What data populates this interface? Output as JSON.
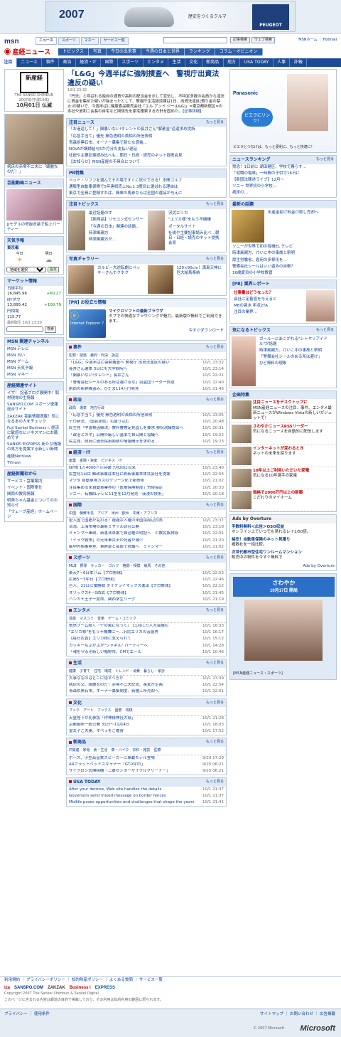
{
  "ad": {
    "year": "2007",
    "copy": "歴史をつくるクルマ",
    "brand": "PEUGEOT"
  },
  "header": {
    "logo": "msn",
    "tabs": [
      "ニュース",
      "スポーツ",
      "マネー",
      "サービス一覧"
    ],
    "search_btn1": "記事検索",
    "search_btn2": "ウェブ検索",
    "links": "MSNホーム ｜ Hotmail",
    "brand": "産経ニュース"
  },
  "subnav": [
    "トピックス",
    "写真",
    "今日の出来事",
    "今週の日本と世界",
    "ランキング",
    "コラム・オピニオン"
  ],
  "mainnav": [
    "注目",
    "ニュース",
    "事件",
    "政治",
    "経済・IT",
    "国際",
    "スポーツ",
    "エンタメ",
    "生活",
    "文化",
    "新商品",
    "地方",
    "USA TODAY",
    "人事",
    "訃報"
  ],
  "left": {
    "paper_title": "新産経",
    "paper_sub": "THE SANKEI SHIMBUN",
    "date": "2007年(平成19年)",
    "date2": "10月01日 仏滅",
    "girl_caption": "病床の赤塚不二夫に「綺麗なのだ！」",
    "ent_head": "芸能動画ニュース",
    "ent_caption": "JJモデルの奇抜衣装で船上パーティー",
    "weather_head": "天気予報",
    "weather_city": "東京都",
    "weather_today": "今日",
    "weather_tomorrow": "明日",
    "weather_sel": "地域を選択",
    "weather_btn": "設定",
    "market_head": "マーケット情報",
    "market": [
      {
        "name": "日経平均",
        "val": "16,845.96",
        "chg": "+60.27"
      },
      {
        "name": "NYダウ",
        "val": "13,895.42",
        "chg": "+100.79"
      },
      {
        "name": "円相場",
        "val": "115.77",
        "chg": ""
      }
    ],
    "market_time": "最終取引 10/1 23:50",
    "stock_btn": "検索",
    "channel_head": "MSN 関連チャンネル",
    "channels": [
      "MSN テレビ",
      "MSN 占い",
      "MSN ゲーム",
      "MSN 天気予報",
      "MSN マネー"
    ],
    "sankei_head": "産経関連サイト",
    "sankei": [
      "イザ！ 記者ブログ展開中！取材現場の生情報",
      "SANSPO.COM スポーツ速報総合サイト",
      "ZAKZAK 芸能情報満載！気になるあの人をチェック",
      "Fuji Sankei Business i. 経済に敏感なビジネスマンにお薦めです",
      "SANKEI EXPRESS 新たな情報の見方を提案する新しい新聞",
      "産経NetView",
      "TVnavi"
    ],
    "corp_head": "産経新聞社から",
    "corp": [
      "サービス・営業案内",
      "イベント・国際奉仕",
      "関西の教育情報",
      "明美ちゃん基金についてのお知らせ",
      "「ウェーブ産経」ホームページ"
    ]
  },
  "center": {
    "lead_title": "「L&G」今週半ばに強制捜査へ　警視庁出資法違反の疑い",
    "lead_time": "10/1 23:32",
    "lead_body": "「円天」と呼ばれる独自の通貨や高利の配当金を示して宣伝し、不特定多数の会員から違法に資金を集めた疑いが強まったとして、警視庁生活経済課は1日、出資法違反(預り金の禁止)の疑いで、今週半ばに健康食品販売会社「エル アンド ジー(L&G)」=東京都新宿区=の本社や波和二会長の自宅など関係先を家宅捜索する方針を固めた。",
    "lead_more": "【記事詳細】",
    "chumoku_head": "注目ニュース",
    "more": "もっと見る",
    "chumoku": [
      "「お追返して！」関暴いない!タレントの長井さん\"解散金\"返還求め提訴",
      "「応急手当て」優先 無色透明の首相の所信表明",
      "青森県黒石市、オーナー募集で新たな感電…",
      "NOVAが講師給与5か月分の支払い遅延",
      "社説や主要記事読み比べも…朝日・日経・読売のネット提携会見",
      "【お知らせ】MSN産経の不具合について"
    ],
    "pr_head": "PR特集",
    "pr": [
      "ベッド・ソファを選んでその場ですぐに試せできる！本間ゴルフ",
      "通販型自動車保険で5年連続売上No.1 3度目に選ばれる理由は",
      "東京で全員に登録すれば、簡単の馬券ならば全国の選品が与えに"
    ],
    "topic_head": "注目トピックス",
    "topic_a": [
      "最近話題のIT",
      "【新商品】リモコン式センサー",
      "「今週の日本」関連の話題…",
      "時津風親方",
      "時津風親方が…"
    ],
    "topic_b": [
      "沢尻エリカ",
      "\"エリカ様\"をもう不機嫌",
      "ポータルサイト",
      "社説や主要記事読み比べ…朝日・日経・読売のネット提携会見"
    ],
    "photo_head": "写真ギャラリー",
    "photo_a": "カルビー大逆転劇にペッキーさんホクホク",
    "photo_b": "120×90cm！満島天神に巨大絵馬奉納",
    "ie_head": "[PR] お役立ち情報",
    "ie_title": "マイクロソフトの最新ブラウザ",
    "ie_body": "タブでの快適なブラウジングが魅力。最新版が無料でご利用できます。",
    "ie_more": "今すぐダウンロード",
    "ie_logo": "Internet Explorer 7",
    "jiken_head": "事件",
    "jiken_cats": "犯罪・疑惑　裁判・判決　訴訟",
    "jiken": [
      {
        "h": "「L&G」今週半ばに強制捜査へ 警視庁 出資法違反の疑い",
        "t": "10/1 23:32"
      },
      {
        "h": "長井さん遺体 3日にも大学病院へ",
        "t": "10/1 23:14"
      },
      {
        "h": "「関暴いない!タレント」長井さん",
        "t": "10/1 22:21"
      },
      {
        "h": "「警備会社シールのある所は避けるな」窃盗団リーダー供述",
        "t": "10/1 22:40"
      },
      {
        "h": "JR西の新幹線盗み、ひだま114万円発見",
        "t": "10/1 21:46"
      }
    ],
    "seiji_head": "政治",
    "seiji_cats": "政局　選挙　地方行政",
    "seiji": [
      {
        "h": "「応急手当て」優先 無色透明の首相の所信表明",
        "t": "10/1 23:05"
      },
      {
        "h": "テロ新法、「国会承認」も盛り込む",
        "t": "10/1 20:48"
      },
      {
        "h": "民主党「中曽根因縁決」教科書検定見直しを要求 参院決議提出へ",
        "t": "10/1 20:31"
      },
      {
        "h": "「政治とカネ」公開の厳しい基準で自公間と協議へ",
        "t": "10/1 19:52"
      },
      {
        "h": "民主党、政府に過去採用面積の情報開示を求める…",
        "t": "10/1 19:23"
      }
    ],
    "keizai_head": "経済・IT",
    "keizai_cats": "産業　金融・資産　ビジネス　IT",
    "keizai": [
      {
        "h": "NY株 1万4000ドル突破 7月20日以来",
        "t": "10/1 23:40"
      },
      {
        "h": "民営化1日目 郵政事業は本社に刷新事業本体式会社を提案",
        "t": "10/1 22:54"
      },
      {
        "h": "マツダ 自動車排ガスのクリーン化で新技術",
        "t": "10/1 21:02"
      },
      {
        "h": "注目集める米自動車業界の「医療保険制度」労使協定",
        "t": "10/1 20:33"
      },
      {
        "h": "ソニー、有機ELテレビ11型を12月発売「液浸の技術」",
        "t": "10/1 20:18"
      }
    ],
    "kokusai_head": "国際",
    "kokusai_cats": "中国　朝鮮半島　アジア　米州　欧州　中東・アフリカ",
    "kokusai": [
      {
        "h": "密入国で国籍が変わる？複雑な人権の米国境周辺対策",
        "t": "10/1 23:37"
      },
      {
        "h": "台湾、上海市場の最新ミサイル研究公開",
        "t": "10/1 23:18"
      },
      {
        "h": "ミャンマー軍政、新憲法草案で自治権の明記へ　少数民族排除",
        "t": "10/1 22:01"
      },
      {
        "h": "「イラク戦争」の元米軍兵士の死者が減少",
        "t": "10/1 21:20"
      },
      {
        "h": "厳中外相事務室、軍幹部と会談で抗議へ　ミャンマー",
        "t": "10/1 21:02"
      }
    ],
    "sports_head": "スポーツ",
    "sports_cats": "MLB　野球　サッカー　ゴルフ　格闘・相撲　競馬　その他",
    "sports": [
      {
        "h": "楽天7－6日本ハム【プロ野球】",
        "t": "10/1 22:53"
      },
      {
        "h": "広島5－3中日【プロ野球】",
        "t": "10/1 22:46"
      },
      {
        "h": "巨人、21日に優勝戦 ダイクライマックス進出【プロ野球】",
        "t": "10/1 22:12"
      },
      {
        "h": "オリックス4－0西武【プロ野球】",
        "t": "10/1 21:45"
      },
      {
        "h": "ハンカチ王子一度命、関西学生リーグ",
        "t": "10/1 21:19"
      }
    ],
    "ent_head": "エンタメ",
    "ent_cats": "芸能　マスコミ　音楽　ゲーム・コミック",
    "ent": [
      {
        "h": "依然ブーム続く「千の風になって」 11月に万人大会論も",
        "t": "10/1 16:33"
      },
      {
        "h": "\"エリカ様\"をもう不機嫌にー…沢尻エリカの芸能界",
        "t": "10/1 16:17"
      },
      {
        "h": "【毎日広告】エリカ様に支えられて",
        "t": "10/1 15:12"
      },
      {
        "h": "ガッキーもぶかぶか\"シャネル\" パーティーへ",
        "t": "10/1 14:28"
      },
      {
        "h": "「魂を守るぞ新しい賭野市、CMでエール",
        "t": "10/1 10:46"
      }
    ],
    "seikatsu_head": "生活",
    "seikatsu_cats": "健康　子育て　住宅　環境　トレンド・消費　暮らし・家計",
    "seikatsu": [
      {
        "h": "大事なものはどこに隠すべきか",
        "t": "10/1 23:39"
      },
      {
        "h": "病床の父、綺麗なのだ！赤塚不二夫記念、長女が企画",
        "t": "10/1 22:54"
      },
      {
        "h": "青森県黒石市、オーナー募集制度、新施工所売却へ",
        "t": "10/1 22:01"
      }
    ],
    "bunka_head": "文化",
    "bunka_cats": "ブック　アート　ブックス　囲碁　将棋",
    "bunka": [
      {
        "h": "天皇陛下が初参加「作神様神社大祭」",
        "t": "10/1 21:28"
      },
      {
        "h": "京都御所一般公開 31日～11月4日",
        "t": "10/1 18:03"
      },
      {
        "h": "皇太子ご夫妻、オペラをご鑑賞",
        "t": "10/1 17:52"
      }
    ],
    "shohin_head": "新商品",
    "shohin_cats": "IT関連　家電　食・生活　車・バイク　衣料・雑貨　医療",
    "shohin": [
      {
        "h": "ボーズ、小型高音質スピーカーに車載モデル登場",
        "t": "9/20 17:29"
      },
      {
        "h": "A4フラットベッドスキャナー「GT-X970」",
        "t": "9/25 06:21"
      },
      {
        "h": "サイクロン式掃除機「三菱センターサイクルクリーナー」",
        "t": "9/25 06:21"
      }
    ],
    "usa_head": "USA TODAY",
    "usa": [
      {
        "h": "After your demise, Web site handles the details",
        "t": "10/1 21:37"
      },
      {
        "h": "Governors send mixed message on border fences",
        "t": "10/1 21:37"
      },
      {
        "h": "Midlife poses opportunities and challenges that shape the years",
        "t": "10/1 21:41"
      }
    ]
  },
  "right": {
    "pana_title": "Panasonic",
    "pana_copy": "ビエラにリンク！",
    "pana_note": "ビエラとつなげば、もっと便利に、もっと快適に！",
    "rank_head": "ニュースランキング",
    "rank": [
      "残念！1日前に 湖田健区、学校で暮らす…",
      "「就職の電車」一時間の子供で16日に",
      "【新国法陳述ライブ】12月～",
      "ソニー 世界初の小学校…",
      "病床の…"
    ],
    "latest_head": "最新の話題",
    "latest": [
      "出産金拡げ料金ロ取し売却へ",
      "ソニーが世界で初の有機EL テレビ",
      "時津風親方、けいこ中の事故と釈明",
      "厚生労働省、雇用の多様化を…",
      "警備会社シールはいい盗みの自衛？",
      "16歳夏目の小学校教習"
    ],
    "job_head": "[PR] 業界レポート",
    "job": [
      "仕事量はどうなった？",
      "会社に定着感を与えると",
      "MBの賃水 年収2TA",
      "注目の業界…"
    ],
    "topics_head": "気になるトピックス",
    "topics": [
      "ガールーにあこがれる\"シャヤリアイドル\"が話題",
      "時津風親方、けいこ中の事故と釈明",
      "「警備会社シールのある所は避け」",
      "ひど無料の現象"
    ],
    "kikaku_head": "企画特集",
    "kikaku": [
      {
        "t": "注目ニュースをデスクトップに",
        "d": "MSN産経ニュースの注目、事件、エンタメ最新ニュースがWindows Vistaの新しいガジェットで！"
      },
      {
        "t": "さわやかニュースRSSリーダー",
        "d": "気になるニュースを自動的に配信します"
      },
      {
        "t": "インターネットが変わるとき",
        "d": "ネットの未来を探ります"
      },
      {
        "t": "10年以上ご利用いただいた家電",
        "d": "気になる10年選手の家電"
      },
      {
        "t": "価格で2000万円以上の新築",
        "d": "こだわりのマイホーム"
      }
    ],
    "overture_head": "Ads by Overture",
    "overture": [
      {
        "t": "手数料無料＜広告＞OSO収益",
        "d": "オンライン上でいつでも見れるレイ1/50倍。"
      },
      {
        "t": "格安！自動車保険のネット見積り",
        "d": "複数社を一括比較。"
      },
      {
        "t": "次世代都市型住宅ワンルームマンション",
        "d": "販売中の物件を今すぐ無料で"
      }
    ],
    "overture_more": "Ads by Overture",
    "video_head": "さわやか",
    "video_date": "10月17日 開局",
    "video_caption": "[MSN産経ニュース・スポーツ]"
  },
  "footer": {
    "links": "利用規約 ｜ プライバシーポリシー ｜ 知的財産ポリシー ｜ よくある質問 ｜ サービス一覧",
    "copy": "Copyright 2007 The Sankei Shimbun & Sankei Digital",
    "logos": [
      "iza",
      "SANSPO.COM",
      "ZAKZAK",
      "Business i",
      "EXPRESS"
    ],
    "note": "このページに含まれる内容は報道の目的で掲載しており、その利用は私的利用の範囲に限られます。",
    "ms_links": "プライバシー ｜ 使用条件",
    "ms_copy": "© 2007 Microsoft",
    "ms_right": "サイトマップ ｜ お問い合わせ ｜ 広告掲載",
    "ms_logo": "Microsoft"
  },
  "colors": {
    "navy": "#1c4c98",
    "link": "#0b3d91",
    "boxhead": "#dfe8f5",
    "red": "#c00000"
  }
}
